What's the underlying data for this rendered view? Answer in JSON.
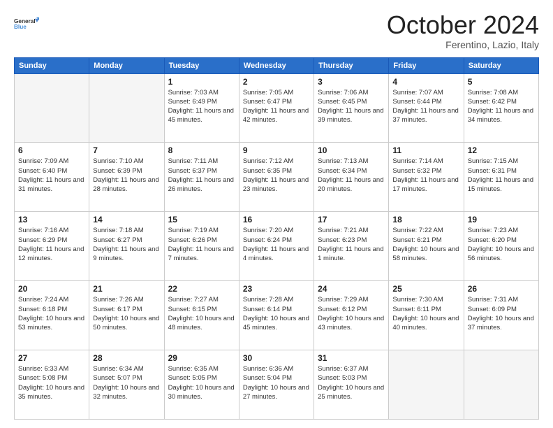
{
  "logo": {
    "line1": "General",
    "line2": "Blue"
  },
  "title": "October 2024",
  "subtitle": "Ferentino, Lazio, Italy",
  "weekdays": [
    "Sunday",
    "Monday",
    "Tuesday",
    "Wednesday",
    "Thursday",
    "Friday",
    "Saturday"
  ],
  "weeks": [
    [
      {
        "day": "",
        "info": ""
      },
      {
        "day": "",
        "info": ""
      },
      {
        "day": "1",
        "info": "Sunrise: 7:03 AM\nSunset: 6:49 PM\nDaylight: 11 hours and 45 minutes."
      },
      {
        "day": "2",
        "info": "Sunrise: 7:05 AM\nSunset: 6:47 PM\nDaylight: 11 hours and 42 minutes."
      },
      {
        "day": "3",
        "info": "Sunrise: 7:06 AM\nSunset: 6:45 PM\nDaylight: 11 hours and 39 minutes."
      },
      {
        "day": "4",
        "info": "Sunrise: 7:07 AM\nSunset: 6:44 PM\nDaylight: 11 hours and 37 minutes."
      },
      {
        "day": "5",
        "info": "Sunrise: 7:08 AM\nSunset: 6:42 PM\nDaylight: 11 hours and 34 minutes."
      }
    ],
    [
      {
        "day": "6",
        "info": "Sunrise: 7:09 AM\nSunset: 6:40 PM\nDaylight: 11 hours and 31 minutes."
      },
      {
        "day": "7",
        "info": "Sunrise: 7:10 AM\nSunset: 6:39 PM\nDaylight: 11 hours and 28 minutes."
      },
      {
        "day": "8",
        "info": "Sunrise: 7:11 AM\nSunset: 6:37 PM\nDaylight: 11 hours and 26 minutes."
      },
      {
        "day": "9",
        "info": "Sunrise: 7:12 AM\nSunset: 6:35 PM\nDaylight: 11 hours and 23 minutes."
      },
      {
        "day": "10",
        "info": "Sunrise: 7:13 AM\nSunset: 6:34 PM\nDaylight: 11 hours and 20 minutes."
      },
      {
        "day": "11",
        "info": "Sunrise: 7:14 AM\nSunset: 6:32 PM\nDaylight: 11 hours and 17 minutes."
      },
      {
        "day": "12",
        "info": "Sunrise: 7:15 AM\nSunset: 6:31 PM\nDaylight: 11 hours and 15 minutes."
      }
    ],
    [
      {
        "day": "13",
        "info": "Sunrise: 7:16 AM\nSunset: 6:29 PM\nDaylight: 11 hours and 12 minutes."
      },
      {
        "day": "14",
        "info": "Sunrise: 7:18 AM\nSunset: 6:27 PM\nDaylight: 11 hours and 9 minutes."
      },
      {
        "day": "15",
        "info": "Sunrise: 7:19 AM\nSunset: 6:26 PM\nDaylight: 11 hours and 7 minutes."
      },
      {
        "day": "16",
        "info": "Sunrise: 7:20 AM\nSunset: 6:24 PM\nDaylight: 11 hours and 4 minutes."
      },
      {
        "day": "17",
        "info": "Sunrise: 7:21 AM\nSunset: 6:23 PM\nDaylight: 11 hours and 1 minute."
      },
      {
        "day": "18",
        "info": "Sunrise: 7:22 AM\nSunset: 6:21 PM\nDaylight: 10 hours and 58 minutes."
      },
      {
        "day": "19",
        "info": "Sunrise: 7:23 AM\nSunset: 6:20 PM\nDaylight: 10 hours and 56 minutes."
      }
    ],
    [
      {
        "day": "20",
        "info": "Sunrise: 7:24 AM\nSunset: 6:18 PM\nDaylight: 10 hours and 53 minutes."
      },
      {
        "day": "21",
        "info": "Sunrise: 7:26 AM\nSunset: 6:17 PM\nDaylight: 10 hours and 50 minutes."
      },
      {
        "day": "22",
        "info": "Sunrise: 7:27 AM\nSunset: 6:15 PM\nDaylight: 10 hours and 48 minutes."
      },
      {
        "day": "23",
        "info": "Sunrise: 7:28 AM\nSunset: 6:14 PM\nDaylight: 10 hours and 45 minutes."
      },
      {
        "day": "24",
        "info": "Sunrise: 7:29 AM\nSunset: 6:12 PM\nDaylight: 10 hours and 43 minutes."
      },
      {
        "day": "25",
        "info": "Sunrise: 7:30 AM\nSunset: 6:11 PM\nDaylight: 10 hours and 40 minutes."
      },
      {
        "day": "26",
        "info": "Sunrise: 7:31 AM\nSunset: 6:09 PM\nDaylight: 10 hours and 37 minutes."
      }
    ],
    [
      {
        "day": "27",
        "info": "Sunrise: 6:33 AM\nSunset: 5:08 PM\nDaylight: 10 hours and 35 minutes."
      },
      {
        "day": "28",
        "info": "Sunrise: 6:34 AM\nSunset: 5:07 PM\nDaylight: 10 hours and 32 minutes."
      },
      {
        "day": "29",
        "info": "Sunrise: 6:35 AM\nSunset: 5:05 PM\nDaylight: 10 hours and 30 minutes."
      },
      {
        "day": "30",
        "info": "Sunrise: 6:36 AM\nSunset: 5:04 PM\nDaylight: 10 hours and 27 minutes."
      },
      {
        "day": "31",
        "info": "Sunrise: 6:37 AM\nSunset: 5:03 PM\nDaylight: 10 hours and 25 minutes."
      },
      {
        "day": "",
        "info": ""
      },
      {
        "day": "",
        "info": ""
      }
    ]
  ]
}
